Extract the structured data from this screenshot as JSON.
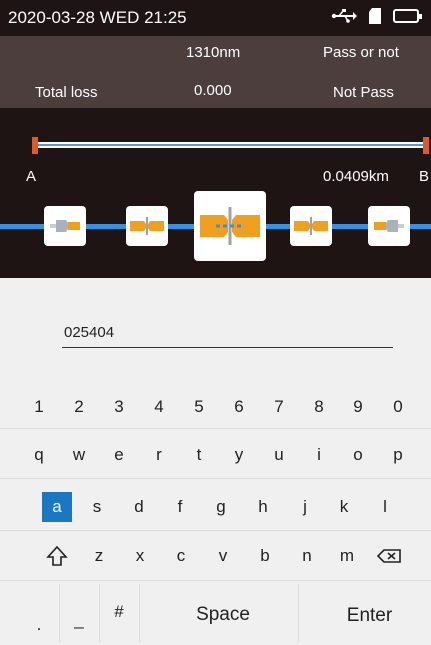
{
  "status": {
    "datetime": "2020-03-28  WED  21:25"
  },
  "info": {
    "wavelength": "1310nm",
    "pass_label": "Pass or not",
    "total_loss_label": "Total loss",
    "loss_value": "0.000",
    "pass_result": "Not Pass"
  },
  "map": {
    "end_a": "A",
    "end_b": "B",
    "distance": "0.0409km"
  },
  "input": {
    "value": "025404"
  },
  "keyboard": {
    "row1": [
      "1",
      "2",
      "3",
      "4",
      "5",
      "6",
      "7",
      "8",
      "9",
      "0"
    ],
    "row2": [
      "q",
      "w",
      "e",
      "r",
      "t",
      "y",
      "u",
      "i",
      "o",
      "p"
    ],
    "row3": [
      "a",
      "s",
      "d",
      "f",
      "g",
      "h",
      "j",
      "k",
      "l"
    ],
    "row4": [
      "z",
      "x",
      "c",
      "v",
      "b",
      "n",
      "m"
    ],
    "row5": [
      ".",
      "_",
      "#"
    ],
    "space_label": "Space",
    "enter_label": "Enter",
    "selected_key": "a"
  },
  "colors": {
    "accent": "#1a78c2",
    "fiber": "#3a90e0",
    "connector": "#f0a020",
    "panel": "#1e1414"
  }
}
